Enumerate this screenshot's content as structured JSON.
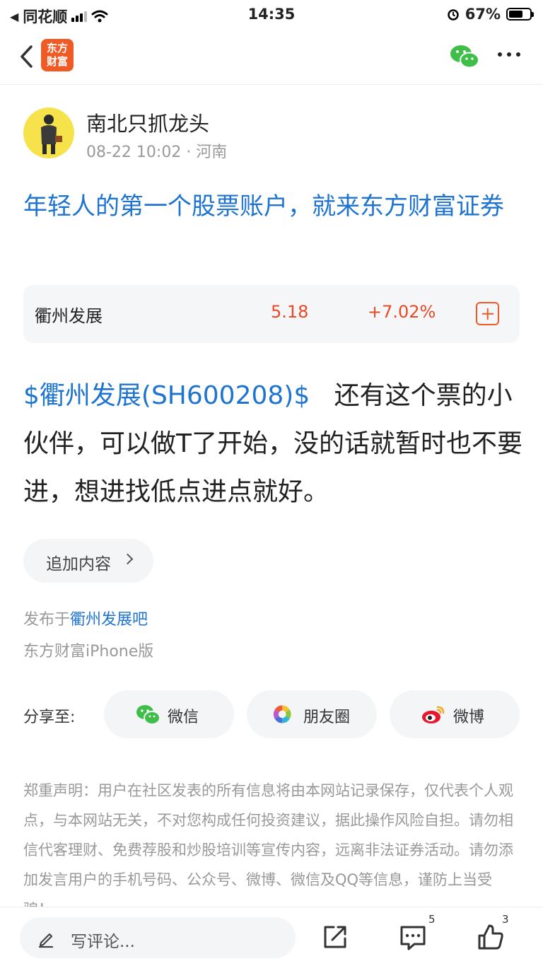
{
  "status_bar": {
    "back_app": "同花顺",
    "time": "14:35",
    "battery": "67%",
    "battery_level": 0.67
  },
  "nav": {
    "logo_text": "东方财富",
    "icons": [
      "back-icon",
      "wechat-icon",
      "more-icon"
    ]
  },
  "author": {
    "name": "南北只抓龙头",
    "meta": "08-22 10:02 · 河南"
  },
  "post": {
    "title": "年轻人的第一个股票账户，就来东方财富证券",
    "stock": {
      "name": "衢州发展",
      "price": "5.18",
      "change": "+7.02%"
    },
    "body_tag": "$衢州发展(SH600208)$",
    "body_text": "还有这个票的小伙伴，可以做T了开始，没的话就暂时也不要进，想进找低点进点就好。",
    "append_label": "追加内容",
    "published_prefix": "发布于",
    "published_board": "衢州发展吧",
    "client": "东方财富iPhone版"
  },
  "share": {
    "label": "分享至:",
    "targets": [
      {
        "label": "微信",
        "icon": "wechat-icon"
      },
      {
        "label": "朋友圈",
        "icon": "moments-icon"
      },
      {
        "label": "微博",
        "icon": "weibo-icon"
      }
    ]
  },
  "disclaimer": "郑重声明：用户在社区发表的所有信息将由本网站记录保存，仅代表个人观点，与本网站无关，不对您构成任何投资建议，据此操作风险自担。请勿相信代客理财、免费荐股和炒股培训等宣传内容，远离非法证券活动。请勿添加发言用户的手机号码、公众号、微博、微信及QQ等信息，谨防上当受骗！",
  "bottom_bar": {
    "comment_placeholder": "写评论...",
    "comment_count": "5",
    "like_count": "3"
  },
  "colors": {
    "link_blue": "#1f74d0",
    "brand_orange": "#f05a24",
    "rise_red": "#e94a25",
    "muted_gray": "#999999"
  }
}
